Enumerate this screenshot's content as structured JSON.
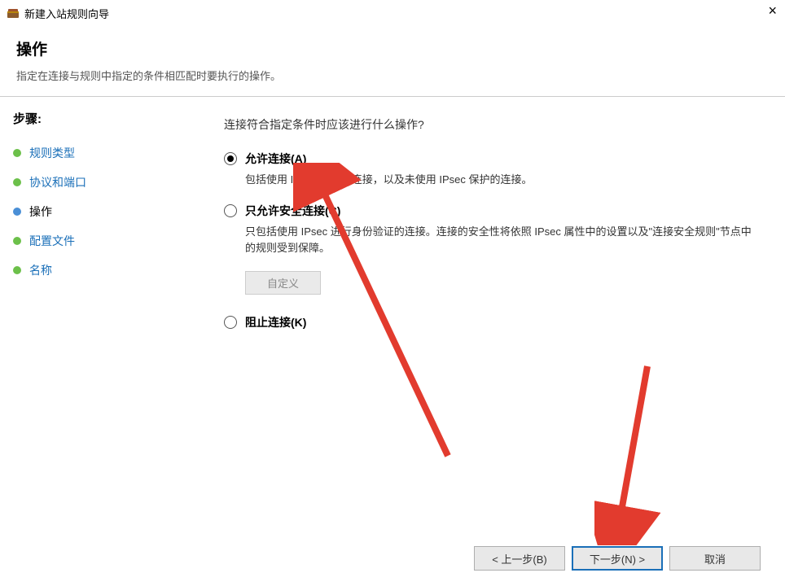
{
  "window": {
    "title": "新建入站规则向导",
    "close": "×"
  },
  "header": {
    "title": "操作",
    "subtitle": "指定在连接与规则中指定的条件相匹配时要执行的操作。"
  },
  "sidebar": {
    "title": "步骤:",
    "steps": [
      {
        "label": "规则类型",
        "bullet": "green",
        "active": false
      },
      {
        "label": "协议和端口",
        "bullet": "green",
        "active": false
      },
      {
        "label": "操作",
        "bullet": "blue",
        "active": true
      },
      {
        "label": "配置文件",
        "bullet": "green",
        "active": false
      },
      {
        "label": "名称",
        "bullet": "green",
        "active": false
      }
    ]
  },
  "content": {
    "question": "连接符合指定条件时应该进行什么操作?",
    "options": [
      {
        "label": "允许连接(A)",
        "description": "包括使用 IPsec 保护的连接，以及未使用 IPsec 保护的连接。",
        "selected": true
      },
      {
        "label": "只允许安全连接(C)",
        "description": "只包括使用 IPsec 进行身份验证的连接。连接的安全性将依照 IPsec 属性中的设置以及\"连接安全规则\"节点中的规则受到保障。",
        "selected": false
      },
      {
        "label": "阻止连接(K)",
        "description": "",
        "selected": false
      }
    ],
    "custom_button": "自定义"
  },
  "footer": {
    "back": "< 上一步(B)",
    "next": "下一步(N) >",
    "cancel": "取消"
  }
}
